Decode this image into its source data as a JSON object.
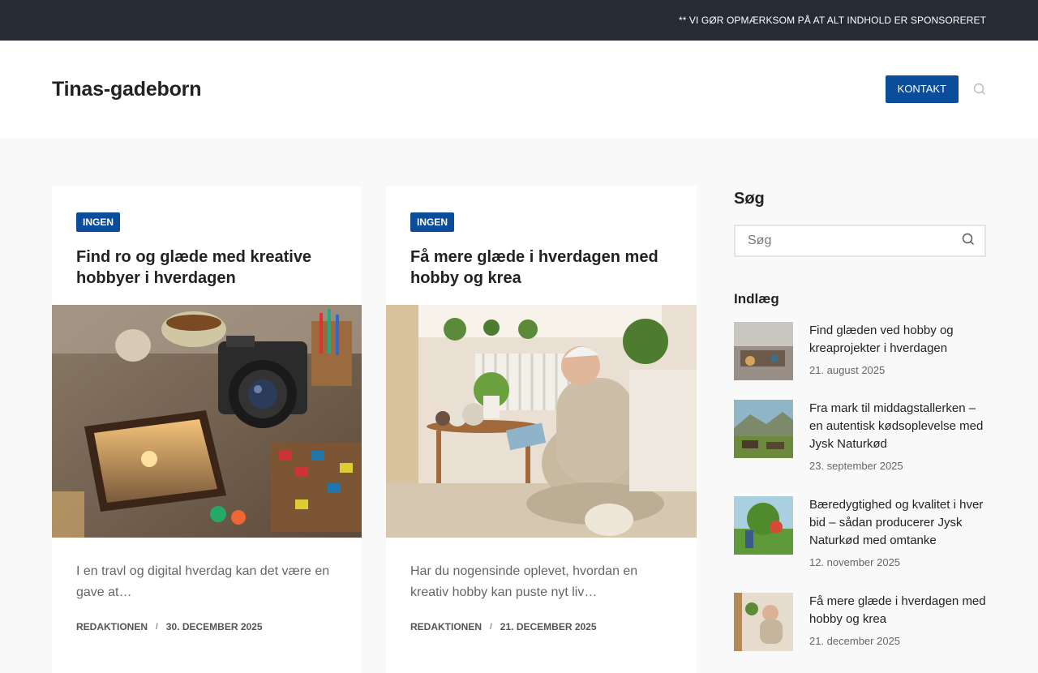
{
  "topbar": {
    "notice": "** VI GØR OPMÆRKSOM PÅ AT ALT INDHOLD ER SPONSORERET"
  },
  "header": {
    "logo": "Tinas-gadeborn",
    "contact_label": "KONTAKT"
  },
  "cards": [
    {
      "badge": "INGEN",
      "title": "Find ro og glæde med kreative hobbyer i hverdagen",
      "excerpt": "I en travl og digital hverdag kan det være en gave at…",
      "author": "REDAKTIONEN",
      "date": "30. DECEMBER 2025"
    },
    {
      "badge": "INGEN",
      "title": "Få mere glæde i hverdagen med hobby og krea",
      "excerpt": "Har du nogensinde oplevet, hvordan en kreativ hobby kan puste nyt liv…",
      "author": "REDAKTIONEN",
      "date": "21. DECEMBER 2025"
    }
  ],
  "sidebar": {
    "search_title": "Søg",
    "search_placeholder": "Søg",
    "posts_title": "Indlæg",
    "posts": [
      {
        "title": "Find glæden ved hobby og kreaprojekter i hverdagen",
        "date": "21. august 2025"
      },
      {
        "title": "Fra mark til middagstallerken – en autentisk kødsoplevelse med Jysk Naturkød",
        "date": "23. september 2025"
      },
      {
        "title": "Bæredygtighed og kvalitet i hver bid – sådan producerer Jysk Naturkød med omtanke",
        "date": "12. november 2025"
      },
      {
        "title": "Få mere glæde i hverdagen med hobby og krea",
        "date": "21. december 2025"
      }
    ]
  },
  "colors": {
    "accent": "#0a4d9b",
    "topbar": "#262c35"
  }
}
